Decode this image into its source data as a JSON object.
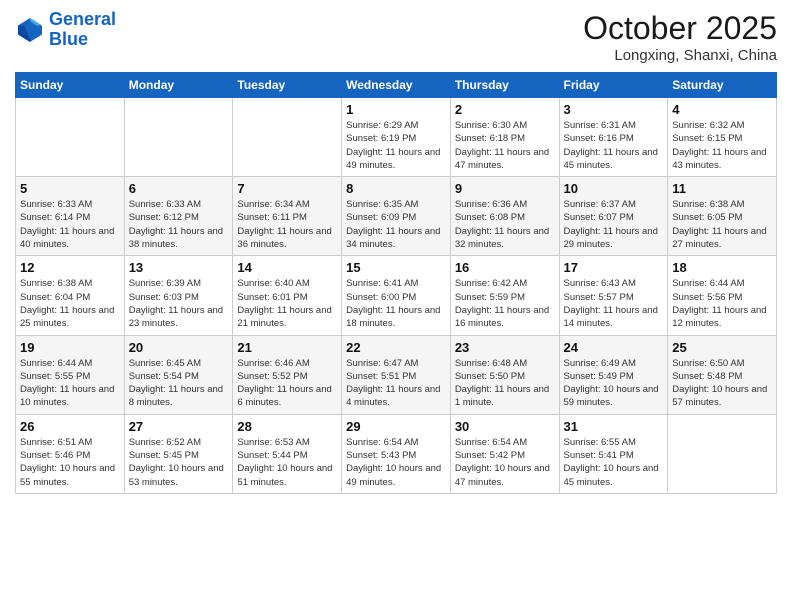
{
  "header": {
    "logo_line1": "General",
    "logo_line2": "Blue",
    "month": "October 2025",
    "location": "Longxing, Shanxi, China"
  },
  "weekdays": [
    "Sunday",
    "Monday",
    "Tuesday",
    "Wednesday",
    "Thursday",
    "Friday",
    "Saturday"
  ],
  "weeks": [
    [
      {
        "day": "",
        "info": ""
      },
      {
        "day": "",
        "info": ""
      },
      {
        "day": "",
        "info": ""
      },
      {
        "day": "1",
        "info": "Sunrise: 6:29 AM\nSunset: 6:19 PM\nDaylight: 11 hours\nand 49 minutes."
      },
      {
        "day": "2",
        "info": "Sunrise: 6:30 AM\nSunset: 6:18 PM\nDaylight: 11 hours\nand 47 minutes."
      },
      {
        "day": "3",
        "info": "Sunrise: 6:31 AM\nSunset: 6:16 PM\nDaylight: 11 hours\nand 45 minutes."
      },
      {
        "day": "4",
        "info": "Sunrise: 6:32 AM\nSunset: 6:15 PM\nDaylight: 11 hours\nand 43 minutes."
      }
    ],
    [
      {
        "day": "5",
        "info": "Sunrise: 6:33 AM\nSunset: 6:14 PM\nDaylight: 11 hours\nand 40 minutes."
      },
      {
        "day": "6",
        "info": "Sunrise: 6:33 AM\nSunset: 6:12 PM\nDaylight: 11 hours\nand 38 minutes."
      },
      {
        "day": "7",
        "info": "Sunrise: 6:34 AM\nSunset: 6:11 PM\nDaylight: 11 hours\nand 36 minutes."
      },
      {
        "day": "8",
        "info": "Sunrise: 6:35 AM\nSunset: 6:09 PM\nDaylight: 11 hours\nand 34 minutes."
      },
      {
        "day": "9",
        "info": "Sunrise: 6:36 AM\nSunset: 6:08 PM\nDaylight: 11 hours\nand 32 minutes."
      },
      {
        "day": "10",
        "info": "Sunrise: 6:37 AM\nSunset: 6:07 PM\nDaylight: 11 hours\nand 29 minutes."
      },
      {
        "day": "11",
        "info": "Sunrise: 6:38 AM\nSunset: 6:05 PM\nDaylight: 11 hours\nand 27 minutes."
      }
    ],
    [
      {
        "day": "12",
        "info": "Sunrise: 6:38 AM\nSunset: 6:04 PM\nDaylight: 11 hours\nand 25 minutes."
      },
      {
        "day": "13",
        "info": "Sunrise: 6:39 AM\nSunset: 6:03 PM\nDaylight: 11 hours\nand 23 minutes."
      },
      {
        "day": "14",
        "info": "Sunrise: 6:40 AM\nSunset: 6:01 PM\nDaylight: 11 hours\nand 21 minutes."
      },
      {
        "day": "15",
        "info": "Sunrise: 6:41 AM\nSunset: 6:00 PM\nDaylight: 11 hours\nand 18 minutes."
      },
      {
        "day": "16",
        "info": "Sunrise: 6:42 AM\nSunset: 5:59 PM\nDaylight: 11 hours\nand 16 minutes."
      },
      {
        "day": "17",
        "info": "Sunrise: 6:43 AM\nSunset: 5:57 PM\nDaylight: 11 hours\nand 14 minutes."
      },
      {
        "day": "18",
        "info": "Sunrise: 6:44 AM\nSunset: 5:56 PM\nDaylight: 11 hours\nand 12 minutes."
      }
    ],
    [
      {
        "day": "19",
        "info": "Sunrise: 6:44 AM\nSunset: 5:55 PM\nDaylight: 11 hours\nand 10 minutes."
      },
      {
        "day": "20",
        "info": "Sunrise: 6:45 AM\nSunset: 5:54 PM\nDaylight: 11 hours\nand 8 minutes."
      },
      {
        "day": "21",
        "info": "Sunrise: 6:46 AM\nSunset: 5:52 PM\nDaylight: 11 hours\nand 6 minutes."
      },
      {
        "day": "22",
        "info": "Sunrise: 6:47 AM\nSunset: 5:51 PM\nDaylight: 11 hours\nand 4 minutes."
      },
      {
        "day": "23",
        "info": "Sunrise: 6:48 AM\nSunset: 5:50 PM\nDaylight: 11 hours\nand 1 minute."
      },
      {
        "day": "24",
        "info": "Sunrise: 6:49 AM\nSunset: 5:49 PM\nDaylight: 10 hours\nand 59 minutes."
      },
      {
        "day": "25",
        "info": "Sunrise: 6:50 AM\nSunset: 5:48 PM\nDaylight: 10 hours\nand 57 minutes."
      }
    ],
    [
      {
        "day": "26",
        "info": "Sunrise: 6:51 AM\nSunset: 5:46 PM\nDaylight: 10 hours\nand 55 minutes."
      },
      {
        "day": "27",
        "info": "Sunrise: 6:52 AM\nSunset: 5:45 PM\nDaylight: 10 hours\nand 53 minutes."
      },
      {
        "day": "28",
        "info": "Sunrise: 6:53 AM\nSunset: 5:44 PM\nDaylight: 10 hours\nand 51 minutes."
      },
      {
        "day": "29",
        "info": "Sunrise: 6:54 AM\nSunset: 5:43 PM\nDaylight: 10 hours\nand 49 minutes."
      },
      {
        "day": "30",
        "info": "Sunrise: 6:54 AM\nSunset: 5:42 PM\nDaylight: 10 hours\nand 47 minutes."
      },
      {
        "day": "31",
        "info": "Sunrise: 6:55 AM\nSunset: 5:41 PM\nDaylight: 10 hours\nand 45 minutes."
      },
      {
        "day": "",
        "info": ""
      }
    ]
  ]
}
